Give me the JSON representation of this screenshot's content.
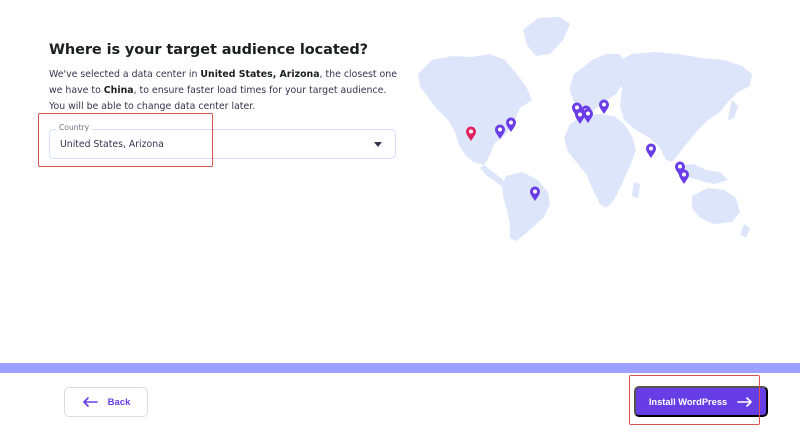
{
  "header": {
    "title": "Where is your target audience located?"
  },
  "description": {
    "part1": "We've selected a data center in ",
    "location": "United States, Arizona",
    "part2": ", the closest one we have to ",
    "country": "China",
    "part3": ", to ensure faster load times for your target audience. You will be able to change data center later."
  },
  "country_select": {
    "label": "Country",
    "value": "United States, Arizona"
  },
  "map": {
    "land_color": "#dde5fb",
    "selected_pin_color": "#e0245e",
    "pin_color": "#6a3de8",
    "selected_pin": "united-states-arizona",
    "pins": [
      "us-west",
      "us-central",
      "us-east",
      "brazil",
      "uk",
      "netherlands",
      "france",
      "germany",
      "lithuania",
      "india",
      "singapore",
      "indonesia"
    ]
  },
  "progress": {
    "fraction": 1.0,
    "colors": {
      "fill": "#9b9fff",
      "track": "#c1c6ff"
    }
  },
  "footer": {
    "back_label": "Back",
    "install_label": "Install WordPress"
  },
  "colors": {
    "accent": "#673de6",
    "highlight": "#d9534f"
  }
}
